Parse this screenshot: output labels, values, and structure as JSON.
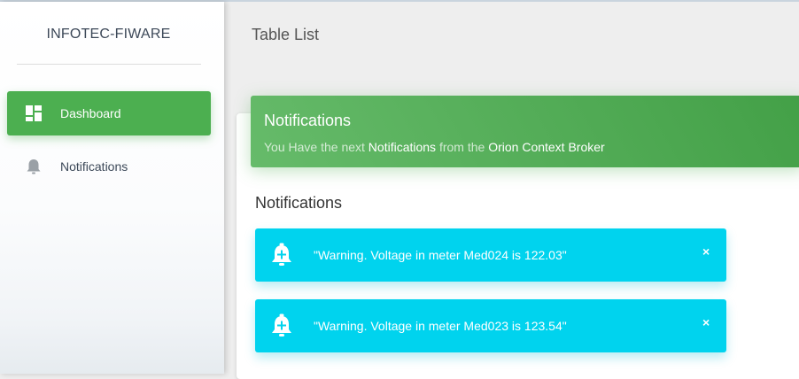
{
  "sidebar": {
    "brand": "INFOTEC-FIWARE",
    "items": [
      {
        "label": "Dashboard",
        "icon": "dashboard-icon",
        "active": true
      },
      {
        "label": "Notifications",
        "icon": "bell-icon",
        "active": false
      }
    ]
  },
  "header": {
    "title": "Table List"
  },
  "card": {
    "title": "Notifications",
    "subtitle_parts": [
      "You Have the next ",
      "Notifications",
      " from the ",
      "Orion Context Broker"
    ]
  },
  "section": {
    "title": "Notifications"
  },
  "alerts": [
    {
      "message": "\"Warning. Voltage in meter Med024 is 122.03\"",
      "close": "×",
      "icon": "bell-plus-icon"
    },
    {
      "message": "\"Warning. Voltage in meter Med023 is 123.54\"",
      "close": "×",
      "icon": "bell-plus-icon"
    }
  ],
  "colors": {
    "accent_green": "#4caf50",
    "alert_cyan": "#00d3ee",
    "sidebar_bg": "#ffffff"
  }
}
